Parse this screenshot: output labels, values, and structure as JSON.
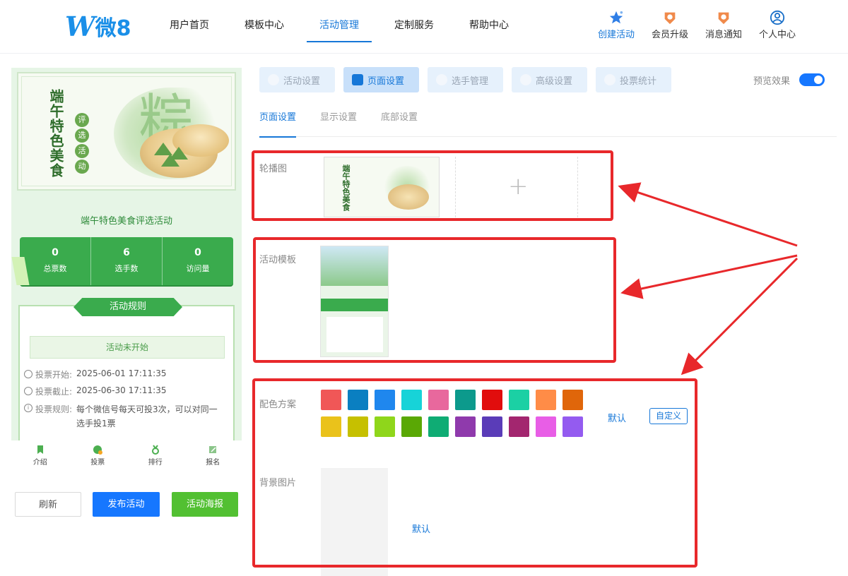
{
  "brand": {
    "logo_letter": "W",
    "logo_text": "微8",
    "color": "#1a8fe8"
  },
  "nav": {
    "items": [
      "用户首页",
      "模板中心",
      "活动管理",
      "定制服务",
      "帮助中心"
    ],
    "active": "活动管理"
  },
  "header_actions": [
    {
      "label": "创建活动",
      "icon": "star-icon"
    },
    {
      "label": "会员升级",
      "icon": "medal-icon"
    },
    {
      "label": "消息通知",
      "icon": "bell-badge-icon"
    },
    {
      "label": "个人中心",
      "icon": "user-icon"
    }
  ],
  "preview": {
    "banner": {
      "title": "端午特色美食",
      "badge_chars": [
        "评",
        "选",
        "活",
        "动"
      ],
      "brush_char": "粽"
    },
    "activity_title": "端午特色美食评选活动",
    "stats": [
      {
        "value": "0",
        "label": "总票数"
      },
      {
        "value": "6",
        "label": "选手数"
      },
      {
        "value": "0",
        "label": "访问量"
      }
    ],
    "rules": {
      "heading": "活动规则",
      "status": "活动未开始",
      "lines": [
        {
          "key": "投票开始:",
          "value": "2025-06-01 17:11:35"
        },
        {
          "key": "投票截止:",
          "value": "2025-06-30 17:11:35"
        },
        {
          "key": "投票规则:",
          "value": "每个微信号每天可投3次，可以对同一选手投1票"
        }
      ]
    },
    "tabbar": [
      {
        "label": "介绍",
        "icon": "bookmark-icon"
      },
      {
        "label": "投票",
        "icon": "vote-icon"
      },
      {
        "label": "排行",
        "icon": "medal-icon"
      },
      {
        "label": "报名",
        "icon": "edit-icon"
      }
    ]
  },
  "actions": {
    "refresh": "刷新",
    "publish": "发布活动",
    "poster": "活动海报"
  },
  "steps": [
    {
      "label": "活动设置",
      "icon": "heart-icon"
    },
    {
      "label": "页面设置",
      "icon": "layout-icon",
      "active": true
    },
    {
      "label": "选手管理",
      "icon": "user-icon"
    },
    {
      "label": "高级设置",
      "icon": "percent-icon"
    },
    {
      "label": "投票统计",
      "icon": "chart-icon"
    }
  ],
  "preview_toggle": {
    "label": "预览效果",
    "on": true
  },
  "subtabs": [
    "页面设置",
    "显示设置",
    "底部设置"
  ],
  "fields": {
    "carousel": "轮播图",
    "template": "活动模板",
    "color_scheme": "配色方案",
    "background": "背景图片"
  },
  "color_scheme": {
    "row1": [
      "#f05757",
      "#0a7fc1",
      "#1f87ee",
      "#17d3d8",
      "#e8689d",
      "#0c9a8c",
      "#e10d0d",
      "#1bd0a4",
      "#ff8c47",
      "#e0660a"
    ],
    "row2": [
      "#eac21b",
      "#c6c000",
      "#8fd61b",
      "#5aa805",
      "#0fac74",
      "#8f3aac",
      "#5a3cb8",
      "#a3266f",
      "#e85ee6",
      "#945bf0"
    ],
    "default_label": "默认",
    "custom_label": "自定义"
  },
  "background": {
    "default_label": "默认"
  },
  "colors": {
    "accent": "#1677ff",
    "green": "#3aab4d",
    "annotation_red": "#e8282b"
  }
}
